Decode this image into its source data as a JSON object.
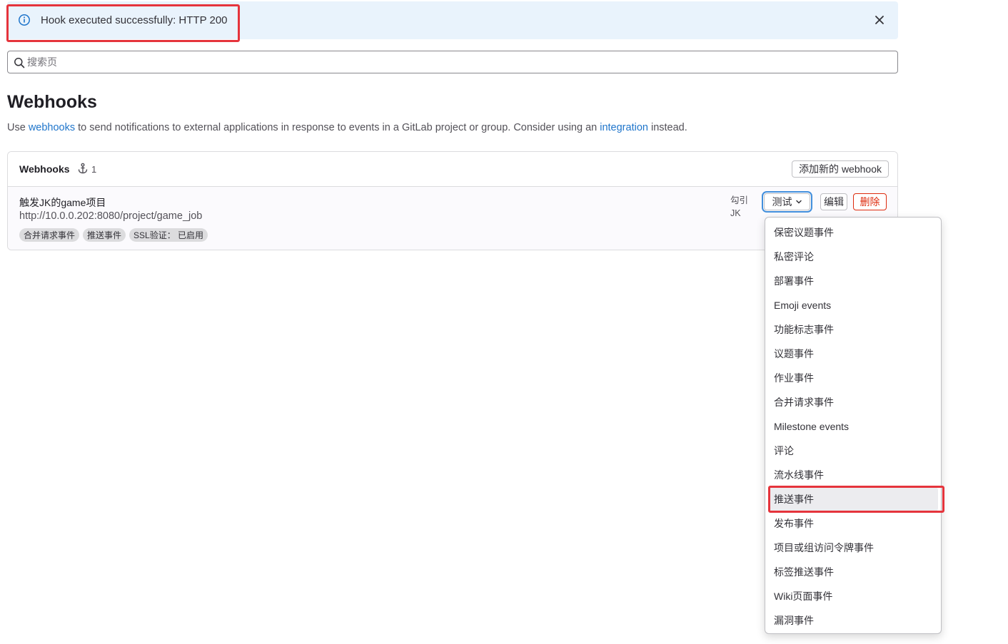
{
  "alert": {
    "message": "Hook executed successfully: HTTP 200",
    "icon": "info-icon",
    "close_icon": "close-icon"
  },
  "search": {
    "placeholder": "搜索页"
  },
  "page": {
    "title": "Webhooks",
    "description": {
      "part1": "Use ",
      "link1": "webhooks",
      "part2": " to send notifications to external applications in response to events in a GitLab project or group. Consider using an ",
      "link2": "integration",
      "part3": " instead."
    }
  },
  "card": {
    "title": "Webhooks",
    "count": "1",
    "add_button": "添加新的 webhook"
  },
  "hook": {
    "name": "触发JK的game项目",
    "url": "http://10.0.0.202:8080/project/game_job",
    "badges": [
      "合并请求事件",
      "推送事件",
      "SSL验证： 已启用"
    ],
    "anchor_line1": "勾引",
    "anchor_line2": "JK",
    "test_button": "测试",
    "edit_button": "编辑",
    "delete_button": "删除"
  },
  "dropdown": {
    "items": [
      "保密议题事件",
      "私密评论",
      "部署事件",
      "Emoji events",
      "功能标志事件",
      "议题事件",
      "作业事件",
      "合并请求事件",
      "Milestone events",
      "评论",
      "流水线事件",
      "推送事件",
      "发布事件",
      "项目或组访问令牌事件",
      "标签推送事件",
      "Wiki页面事件",
      "漏洞事件"
    ],
    "active_item": "推送事件"
  },
  "colors": {
    "highlight": "#e5343c",
    "link": "#1f75cb",
    "danger": "#dd2b0e",
    "alert_bg": "#e9f3fc"
  }
}
